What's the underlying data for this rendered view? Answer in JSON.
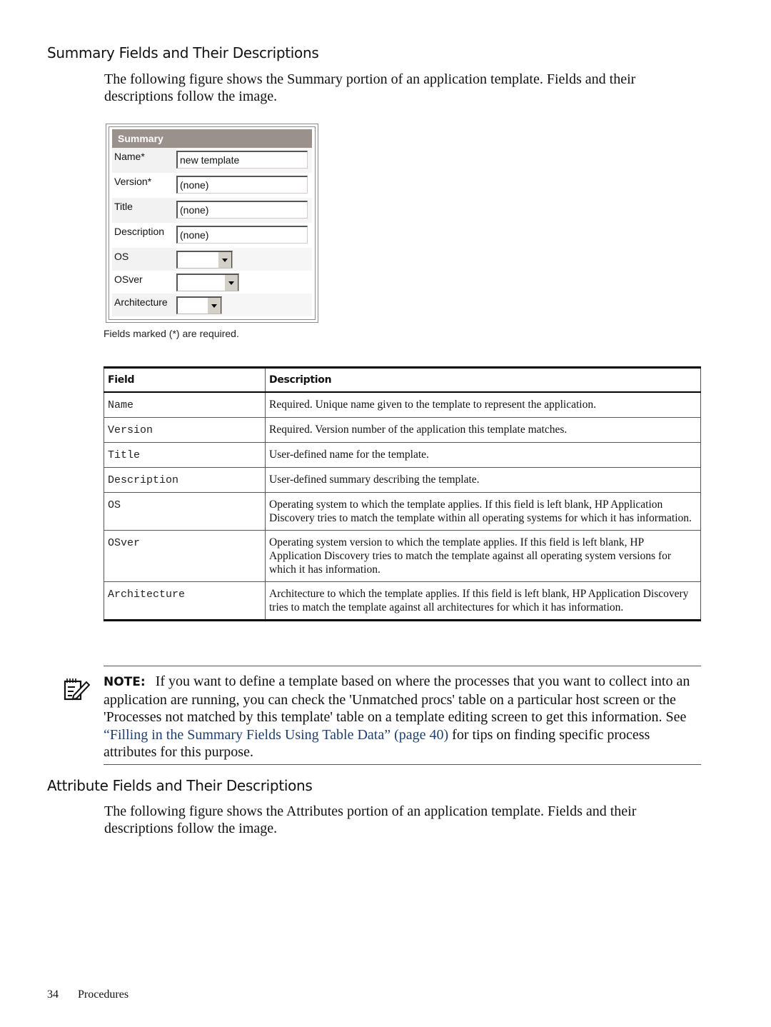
{
  "section1": {
    "heading": "Summary Fields and Their Descriptions",
    "intro": "The following figure shows the Summary portion of an application template. Fields and their descriptions follow the image."
  },
  "figure": {
    "header": "Summary",
    "fields": [
      {
        "label": "Name*",
        "type": "text",
        "value": "new template"
      },
      {
        "label": "Version*",
        "type": "text",
        "value": "(none)"
      },
      {
        "label": "Title",
        "type": "text",
        "value": "(none)"
      },
      {
        "label": "Description",
        "type": "text",
        "value": "(none)"
      },
      {
        "label": "OS",
        "type": "select",
        "value": ""
      },
      {
        "label": "OSver",
        "type": "select",
        "value": ""
      },
      {
        "label": "Architecture",
        "type": "select",
        "value": ""
      }
    ],
    "caption": "Fields marked (*) are required."
  },
  "table": {
    "headers": [
      "Field",
      "Description"
    ],
    "rows": [
      {
        "field": "Name",
        "description": "Required. Unique name given to the template to represent the application."
      },
      {
        "field": "Version",
        "description": "Required. Version number of the application this template matches."
      },
      {
        "field": "Title",
        "description": "User-defined name for the template."
      },
      {
        "field": "Description",
        "description": "User-defined summary describing the template."
      },
      {
        "field": "OS",
        "description": "Operating system to which the template applies. If this field is left blank, HP Application Discovery tries to match the template within all operating systems for which it has information."
      },
      {
        "field": "OSver",
        "description": "Operating system version to which the template applies. If this field is left blank, HP Application Discovery tries to match the template against all operating system versions for which it has information."
      },
      {
        "field": "Architecture",
        "description": "Architecture to which the template applies. If this field is left blank, HP Application Discovery tries to match the template against all architectures for which it has information."
      }
    ]
  },
  "note": {
    "icon": "note-pencil-icon",
    "label": "NOTE:",
    "text_before": "If you want to define a template based on where the processes that you want to collect into an application are running, you can check the 'Unmatched procs' table on a particular host screen or the 'Processes not matched by this template' table on a template editing screen to get this information. See ",
    "link": "“Filling in the Summary Fields Using Table Data” (page 40)",
    "text_after": " for tips on finding specific process attributes for this purpose.",
    "link_color": "#1f3f6f"
  },
  "section2": {
    "heading": "Attribute Fields and Their Descriptions",
    "intro": "The following figure shows the Attributes portion of an application template. Fields and their descriptions follow the image."
  },
  "footer": {
    "page_number": "34",
    "chapter": "Procedures"
  }
}
